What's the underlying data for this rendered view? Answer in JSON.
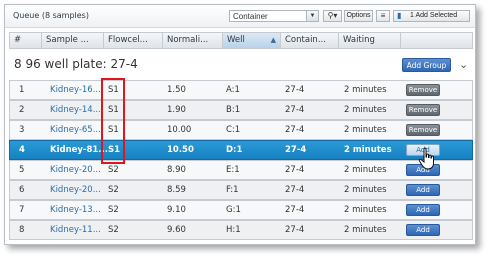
{
  "queue": {
    "title": "Queue (8 samples)",
    "field_select": "Container",
    "options_label": "Options",
    "add_selected_label": "1 Add Selected"
  },
  "columns": [
    "#",
    "Sample ...",
    "Flowcel...",
    "Normali...",
    "Well",
    "Contain...",
    "Waiting"
  ],
  "sorted_column": "Well",
  "group": {
    "label": "96 well plate: 27-4",
    "add_group_label": "Add Group"
  },
  "rows": [
    {
      "num": "1",
      "sample": "Kidney-16...",
      "flowcell": "S1",
      "norm": "1.50",
      "well": "A:1",
      "container": "27-4",
      "waiting": "2 minutes",
      "action": "Remove"
    },
    {
      "num": "2",
      "sample": "Kidney-14...",
      "flowcell": "S1",
      "norm": "1.90",
      "well": "B:1",
      "container": "27-4",
      "waiting": "2 minutes",
      "action": "Remove"
    },
    {
      "num": "3",
      "sample": "Kidney-65...",
      "flowcell": "S1",
      "norm": "10.00",
      "well": "C:1",
      "container": "27-4",
      "waiting": "2 minutes",
      "action": "Remove"
    },
    {
      "num": "4",
      "sample": "Kidney-81...",
      "flowcell": "S1",
      "norm": "10.50",
      "well": "D:1",
      "container": "27-4",
      "waiting": "2 minutes",
      "action": "Add"
    },
    {
      "num": "5",
      "sample": "Kidney-20...",
      "flowcell": "S2",
      "norm": "8.90",
      "well": "E:1",
      "container": "27-4",
      "waiting": "2 minutes",
      "action": "Add"
    },
    {
      "num": "6",
      "sample": "Kidney-20...",
      "flowcell": "S2",
      "norm": "8.59",
      "well": "F:1",
      "container": "27-4",
      "waiting": "2 minutes",
      "action": "Add"
    },
    {
      "num": "7",
      "sample": "Kidney-13...",
      "flowcell": "S2",
      "norm": "9.10",
      "well": "G:1",
      "container": "27-4",
      "waiting": "2 minutes",
      "action": "Add"
    },
    {
      "num": "8",
      "sample": "Kidney-11...",
      "flowcell": "S2",
      "norm": "9.60",
      "well": "H:1",
      "container": "27-4",
      "waiting": "2 minutes",
      "action": "Add"
    }
  ],
  "selected_row": 4,
  "colors": {
    "selected_row": "#1e8ccc",
    "link": "#2a6ea8",
    "highlight": "#e0151d",
    "add_button": "#3a73bd",
    "remove_button": "#6f777e"
  }
}
